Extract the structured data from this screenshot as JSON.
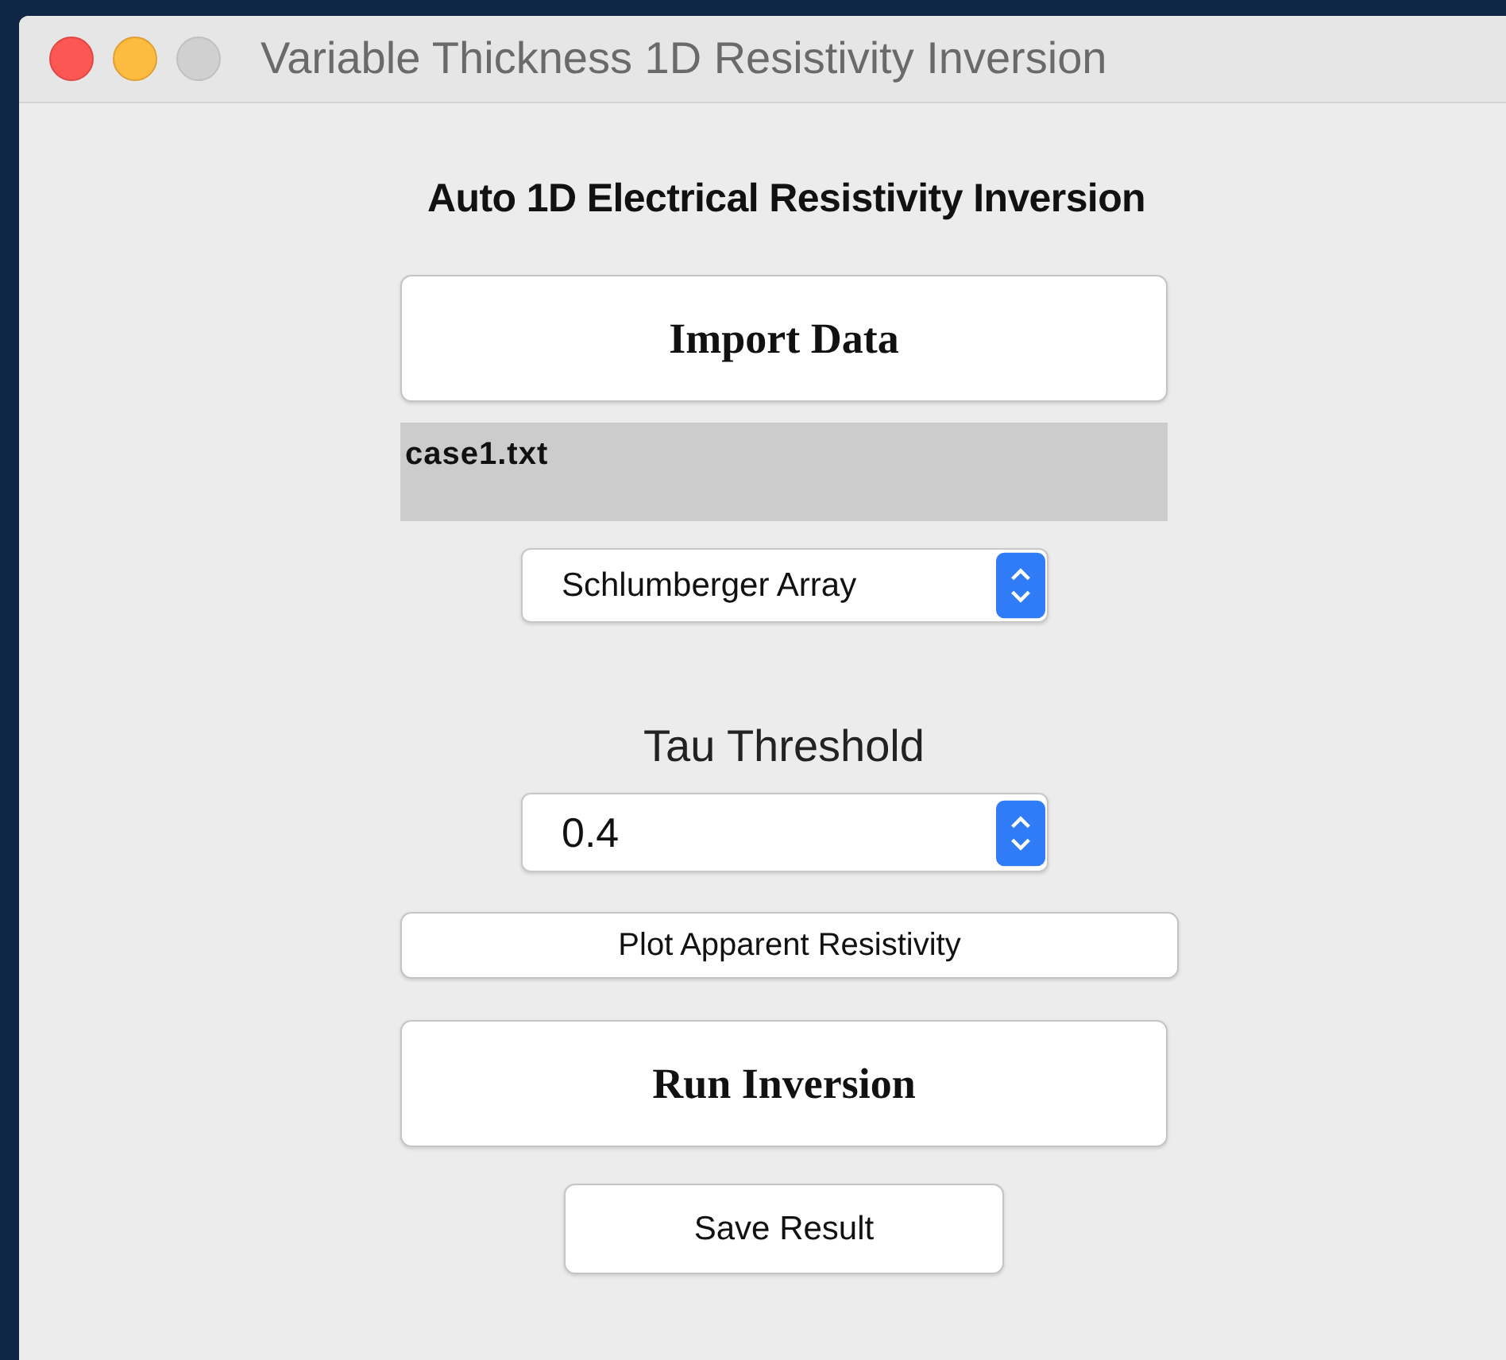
{
  "window": {
    "title": "Variable Thickness 1D Resistivity Inversion",
    "zoom_enabled": false
  },
  "heading": "Auto 1D Electrical Resistivity Inversion",
  "controls": [
    {
      "kind": "big-button",
      "label": "Import Data"
    },
    {
      "kind": "file-label",
      "text": "case1.txt"
    },
    {
      "kind": "dropdown",
      "value": "Schlumberger Array"
    },
    {
      "kind": "label",
      "text": "Tau Threshold"
    },
    {
      "kind": "dropdown",
      "value": "0.4"
    },
    {
      "kind": "wide-button",
      "label": "Plot Apparent Resistivity"
    },
    {
      "kind": "big-button",
      "label": "Run Inversion"
    },
    {
      "kind": "small-button",
      "label": "Save Result"
    }
  ]
}
